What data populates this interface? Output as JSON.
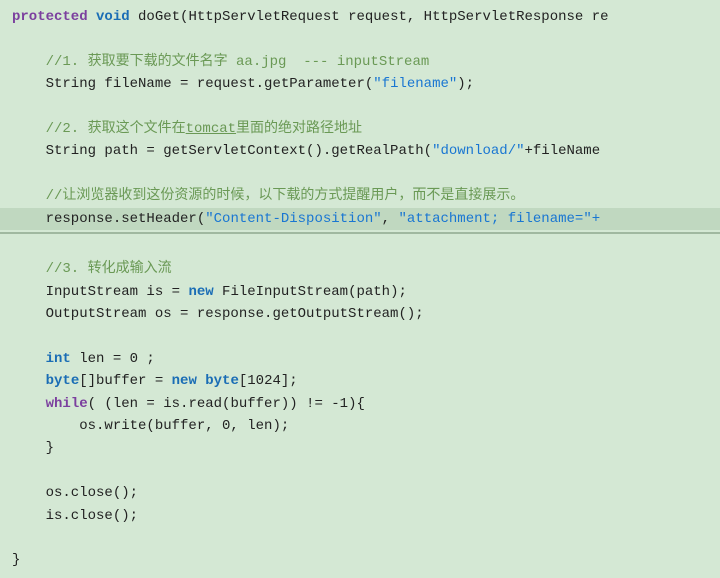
{
  "code": {
    "lines": [
      {
        "id": "line1",
        "highlighted": false,
        "parts": [
          {
            "text": "protected ",
            "cls": "kw-purple"
          },
          {
            "text": "void ",
            "cls": "kw-blue"
          },
          {
            "text": "doGet(HttpServletRequest request, HttpServletResponse re",
            "cls": "plain"
          }
        ]
      },
      {
        "id": "line-blank1",
        "highlighted": false,
        "parts": []
      },
      {
        "id": "line2",
        "highlighted": false,
        "parts": [
          {
            "text": "    //1. 获取要下载的文件名字 aa.jpg  --- inputStream",
            "cls": "comment"
          }
        ]
      },
      {
        "id": "line3",
        "highlighted": false,
        "parts": [
          {
            "text": "    String fileName = request.getParameter(",
            "cls": "plain"
          },
          {
            "text": "\"filename\"",
            "cls": "string"
          },
          {
            "text": ");",
            "cls": "plain"
          }
        ]
      },
      {
        "id": "line-blank2",
        "highlighted": false,
        "parts": []
      },
      {
        "id": "line4",
        "highlighted": false,
        "parts": [
          {
            "text": "    //2. 获取这个文件在",
            "cls": "comment"
          },
          {
            "text": "tomcat",
            "cls": "comment underline"
          },
          {
            "text": "里面的绝对路径地址",
            "cls": "comment"
          }
        ]
      },
      {
        "id": "line5",
        "highlighted": false,
        "parts": [
          {
            "text": "    String path = getServletContext().getRealPath(",
            "cls": "plain"
          },
          {
            "text": "\"download/\"",
            "cls": "string"
          },
          {
            "text": "+fileName",
            "cls": "plain"
          }
        ]
      },
      {
        "id": "line-blank3",
        "highlighted": false,
        "parts": []
      },
      {
        "id": "line6",
        "highlighted": false,
        "parts": [
          {
            "text": "    //让浏览器收到这份资源的时候，以下载的方式提醒用户，而不是直接展示。",
            "cls": "comment"
          }
        ]
      },
      {
        "id": "line7",
        "highlighted": true,
        "parts": [
          {
            "text": "    response.setHeader(",
            "cls": "plain"
          },
          {
            "text": "\"Content-Disposition\"",
            "cls": "string"
          },
          {
            "text": ", ",
            "cls": "plain"
          },
          {
            "text": "\"attachment; filename=\"+",
            "cls": "string"
          }
        ]
      },
      {
        "id": "line-blank4",
        "highlighted": false,
        "parts": []
      },
      {
        "id": "line8",
        "highlighted": false,
        "parts": [
          {
            "text": "    //3. 转化成输入流",
            "cls": "comment"
          }
        ]
      },
      {
        "id": "line9",
        "highlighted": false,
        "parts": [
          {
            "text": "    InputStream is = ",
            "cls": "plain"
          },
          {
            "text": "new ",
            "cls": "kw-blue"
          },
          {
            "text": "FileInputStream(path);",
            "cls": "plain"
          }
        ]
      },
      {
        "id": "line10",
        "highlighted": false,
        "parts": [
          {
            "text": "    OutputStream os = response.getOutputStream();",
            "cls": "plain"
          }
        ]
      },
      {
        "id": "line-blank5",
        "highlighted": false,
        "parts": []
      },
      {
        "id": "line11",
        "highlighted": false,
        "parts": [
          {
            "text": "    ",
            "cls": "plain"
          },
          {
            "text": "int ",
            "cls": "kw-blue"
          },
          {
            "text": "len = 0 ;",
            "cls": "plain"
          }
        ]
      },
      {
        "id": "line12",
        "highlighted": false,
        "parts": [
          {
            "text": "    ",
            "cls": "plain"
          },
          {
            "text": "byte",
            "cls": "kw-blue"
          },
          {
            "text": "[]buffer = ",
            "cls": "plain"
          },
          {
            "text": "new ",
            "cls": "kw-blue"
          },
          {
            "text": "byte",
            "cls": "kw-blue"
          },
          {
            "text": "[1024];",
            "cls": "plain"
          }
        ]
      },
      {
        "id": "line13",
        "highlighted": false,
        "parts": [
          {
            "text": "    ",
            "cls": "plain"
          },
          {
            "text": "while",
            "cls": "kw-purple"
          },
          {
            "text": "( (len = is.read(buffer)) != -1){",
            "cls": "plain"
          }
        ]
      },
      {
        "id": "line14",
        "highlighted": false,
        "parts": [
          {
            "text": "        os.write(buffer, 0, len);",
            "cls": "plain"
          }
        ]
      },
      {
        "id": "line15",
        "highlighted": false,
        "parts": [
          {
            "text": "    }",
            "cls": "plain"
          }
        ]
      },
      {
        "id": "line-blank6",
        "highlighted": false,
        "parts": []
      },
      {
        "id": "line16",
        "highlighted": false,
        "parts": [
          {
            "text": "    os.close();",
            "cls": "plain"
          }
        ]
      },
      {
        "id": "line17",
        "highlighted": false,
        "parts": [
          {
            "text": "    is.close();",
            "cls": "plain"
          }
        ]
      },
      {
        "id": "line-blank7",
        "highlighted": false,
        "parts": []
      },
      {
        "id": "line18",
        "highlighted": false,
        "parts": [
          {
            "text": "}",
            "cls": "plain"
          }
        ]
      }
    ]
  }
}
